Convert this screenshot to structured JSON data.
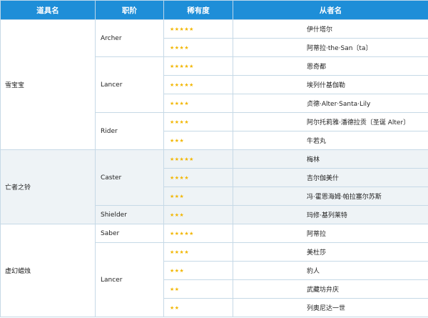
{
  "header": {
    "col_item": "道具名",
    "col_class": "职阶",
    "col_rarity": "稀有度",
    "col_servant": "从者名"
  },
  "style": {
    "header_bg": "#1e8ed8",
    "star_color": "#f2b705",
    "alt_row_bg": "#eef3f6"
  },
  "groups": [
    {
      "item": "雪宝宝",
      "classes": [
        {
          "class": "Archer",
          "rows": [
            {
              "stars": "★★★★★",
              "servant": "伊什塔尔"
            },
            {
              "stars": "★★★★",
              "servant": "阿蒂拉·the·San〔ta〕"
            }
          ]
        },
        {
          "class": "Lancer",
          "rows": [
            {
              "stars": "★★★★★",
              "servant": "恩奇都"
            },
            {
              "stars": "★★★★★",
              "servant": "埃列什基伽勒"
            },
            {
              "stars": "★★★★",
              "servant": "贞德·Alter·Santa·Lily"
            }
          ]
        },
        {
          "class": "Rider",
          "rows": [
            {
              "stars": "★★★★",
              "servant": "阿尔托莉雅·潘德拉贡〔圣诞 Alter〕"
            },
            {
              "stars": "★★★",
              "servant": "牛若丸"
            }
          ]
        }
      ]
    },
    {
      "item": "亡者之铃",
      "classes": [
        {
          "class": "Caster",
          "rows": [
            {
              "stars": "★★★★★",
              "servant": "梅林"
            },
            {
              "stars": "★★★★",
              "servant": "吉尔伽美什"
            },
            {
              "stars": "★★★",
              "servant": "冯·霍恩海姆·帕拉塞尔苏斯"
            }
          ]
        },
        {
          "class": "Shielder",
          "rows": [
            {
              "stars": "★★★",
              "servant": "玛修·基列莱特"
            }
          ]
        }
      ]
    },
    {
      "item": "虚幻蜡烛",
      "classes": [
        {
          "class": "Saber",
          "rows": [
            {
              "stars": "★★★★★",
              "servant": "阿蒂拉"
            }
          ]
        },
        {
          "class": "Lancer",
          "rows": [
            {
              "stars": "★★★★",
              "servant": "美杜莎"
            },
            {
              "stars": "★★★",
              "servant": "豹人"
            },
            {
              "stars": "★★",
              "servant": "武藏坊弁庆"
            },
            {
              "stars": "★★",
              "servant": "列奥尼达一世"
            }
          ]
        }
      ]
    }
  ]
}
